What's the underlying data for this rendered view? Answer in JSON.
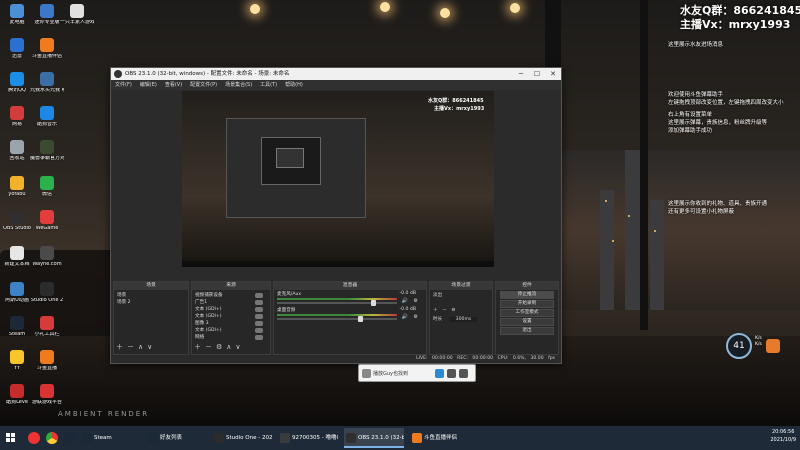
{
  "desktop": {
    "icons": [
      {
        "label": "此电脑",
        "color": "#4b8fd6"
      },
      {
        "label": "迷你专业版",
        "color": "#3b78c8"
      },
      {
        "label": "一只羊素人游戏建议",
        "color": "#e0e0e0"
      },
      {
        "label": "迅雷",
        "color": "#2b6fd0"
      },
      {
        "label": "斗鱼直播伴侣",
        "color": "#f07a1e"
      },
      {
        "label": "腾讯QQ",
        "color": "#1b8fe8"
      },
      {
        "label": "元我水头元我 哪些方程",
        "color": "#3a6ea5"
      },
      {
        "label": "网易",
        "color": "#d23c3c"
      },
      {
        "label": "酷狗音乐",
        "color": "#1d87e5"
      },
      {
        "label": "回收站",
        "color": "#9aa4ad"
      },
      {
        "label": "魔兽争霸官方对战平台",
        "color": "#3a4b30"
      },
      {
        "label": "yofabu",
        "color": "#f2b32a"
      },
      {
        "label": "微信",
        "color": "#2bb24c"
      },
      {
        "label": "OBS Studio",
        "color": "#2f2f2f"
      },
      {
        "label": "WeGame",
        "color": "#e23c3c"
      },
      {
        "label": "新建文本档",
        "color": "#e6e6e6"
      },
      {
        "label": "Wayhe.com",
        "color": "#4a4a4a"
      },
      {
        "label": "阿斯U动画",
        "color": "#3c82c4"
      },
      {
        "label": "Studio One 2",
        "color": "#2b2b2b"
      },
      {
        "label": "Steam",
        "color": "#1b2838"
      },
      {
        "label": "小礼工具栏",
        "color": "#d63a3a"
      },
      {
        "label": "YY",
        "color": "#f7c62b"
      },
      {
        "label": "斗鱼直播",
        "color": "#f07a1e"
      },
      {
        "label": "酷狗Leve",
        "color": "#c62c2c"
      },
      {
        "label": "游联游戏平台",
        "color": "#d93333"
      }
    ]
  },
  "overlay": {
    "qq_group": "水友Q群：866241845",
    "wechat": "主播Vx：mrxy1993",
    "messages": [
      "这里展示水友进场消息",
      "欢迎使用斗鱼弹幕助手",
      "左键拖拽顶部改变位置，左键拖拽四周改变大小",
      "右上角有设置菜单",
      "这里展示弹幕，贵族信息，粉丝牌升级等",
      "添加弹幕助手成功",
      "这里展示你收到的礼物、道具、贵族开通",
      "还有更多可设置小礼物屏蔽"
    ],
    "badge_value": "41",
    "badge_side_1": "K/s",
    "badge_side_2": "K/s"
  },
  "watermark": "AMBIENT RENDER",
  "obs": {
    "title": "OBS 23.1.0 (32-bit, windows) - 配置文件: 未命名 - 场景: 未命名",
    "menu": [
      "文件(F)",
      "编辑(E)",
      "查看(V)",
      "配置文件(P)",
      "场景集合(S)",
      "工具(T)",
      "帮助(H)"
    ],
    "preview_qq": "水友Q群：866241845",
    "preview_vx": "主播Vx：mrxy1993",
    "panes": {
      "scenes": {
        "title": "场景",
        "items": [
          "场景",
          "场景 2"
        ]
      },
      "sources": {
        "title": "来源",
        "items": [
          "视频捕获设备",
          "广告1",
          "文本 (GDI+)",
          "文本 (GDI+)",
          "图像 3",
          "文本 (GDI+)",
          "网络"
        ]
      },
      "mixer": {
        "title": "混音器",
        "channels": [
          {
            "name": "麦克风/Aux",
            "db": "-0.0 dB",
            "level": 0.82
          },
          {
            "name": "桌面音频",
            "db": "-0.0 dB",
            "level": 0.7
          }
        ]
      },
      "transitions": {
        "title": "场景过渡",
        "type": "淡出",
        "duration_label": "时长",
        "duration": "300ms"
      },
      "controls": {
        "title": "控件",
        "buttons": [
          "停止推流",
          "开始录制",
          "工作室模式",
          "设置",
          "退出"
        ]
      }
    },
    "status": "LIVE: 00:00:00   REC: 00:00:00   CPU: 0.6%, 30.00 fps"
  },
  "popup": {
    "text": "播放Guy也找到"
  },
  "taskbar": {
    "apps": [
      {
        "label": "Steam",
        "color": "#1b2838"
      },
      {
        "label": "好友列表",
        "color": "#1b2838"
      },
      {
        "label": "Studio One - 202...",
        "color": "#2b2b2b"
      },
      {
        "label": "92700305 - 噜噜Ga...",
        "color": "#3a3a3a"
      },
      {
        "label": "OBS 23.1.0 (32-bi...",
        "color": "#2f2f2f"
      },
      {
        "label": "斗鱼直播伴侣",
        "color": "#f07a1e"
      }
    ],
    "time": "20:06:56",
    "date": "2021/10/9"
  }
}
